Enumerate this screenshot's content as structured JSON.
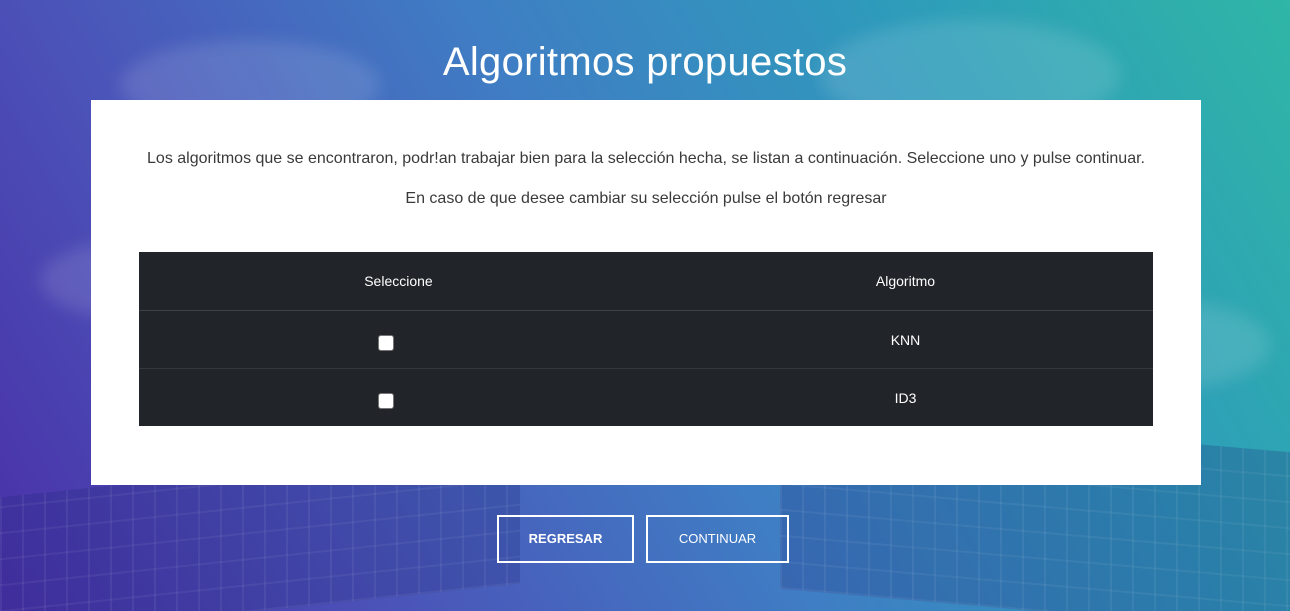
{
  "page": {
    "title": "Algoritmos propuestos"
  },
  "card": {
    "intro_text": "Los algoritmos que se encontraron, podr!an trabajar bien para la selección hecha, se listan a continuación. Seleccione uno y pulse continuar.",
    "intro_text_2": "En caso de que desee cambiar su selección pulse el botón regresar"
  },
  "table": {
    "headers": {
      "select": "Seleccione",
      "algorithm": "Algoritmo"
    },
    "rows": [
      {
        "algorithm": "KNN",
        "checked": false
      },
      {
        "algorithm": "ID3",
        "checked": false
      }
    ]
  },
  "buttons": {
    "back_label": "REGRESAR",
    "continue_label": "CONTINUAR"
  },
  "colors": {
    "table_bg": "#212529",
    "card_bg": "#ffffff",
    "gradient_start": "#4a2fa8",
    "gradient_end": "#2fb6a6"
  }
}
